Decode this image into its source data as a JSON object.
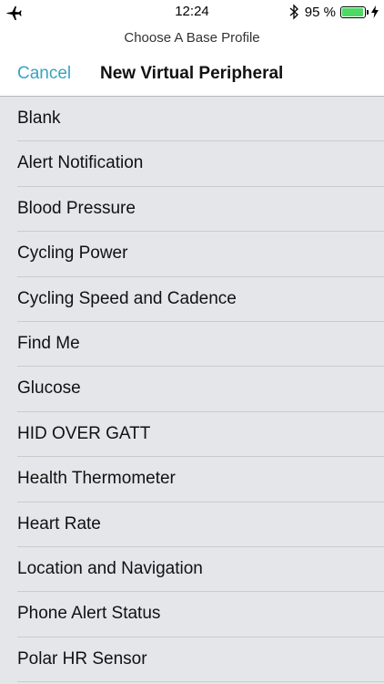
{
  "status_bar": {
    "time": "12:24",
    "battery_percent": "95 %",
    "battery_level": 0.95,
    "icons": [
      "airplane-icon",
      "bluetooth-icon",
      "battery-icon",
      "charging-bolt-icon"
    ],
    "battery_color": "#4cd964"
  },
  "header": {
    "prompt": "Choose A Base Profile",
    "cancel_label": "Cancel",
    "title": "New Virtual Peripheral",
    "accent_color": "#3aa3c3"
  },
  "profiles": [
    "Blank",
    "Alert Notification",
    "Blood Pressure",
    "Cycling Power",
    "Cycling Speed and Cadence",
    "Find Me",
    "Glucose",
    "HID OVER GATT",
    "Health Thermometer",
    "Heart Rate",
    "Location and Navigation",
    "Phone Alert Status",
    "Polar HR Sensor"
  ]
}
